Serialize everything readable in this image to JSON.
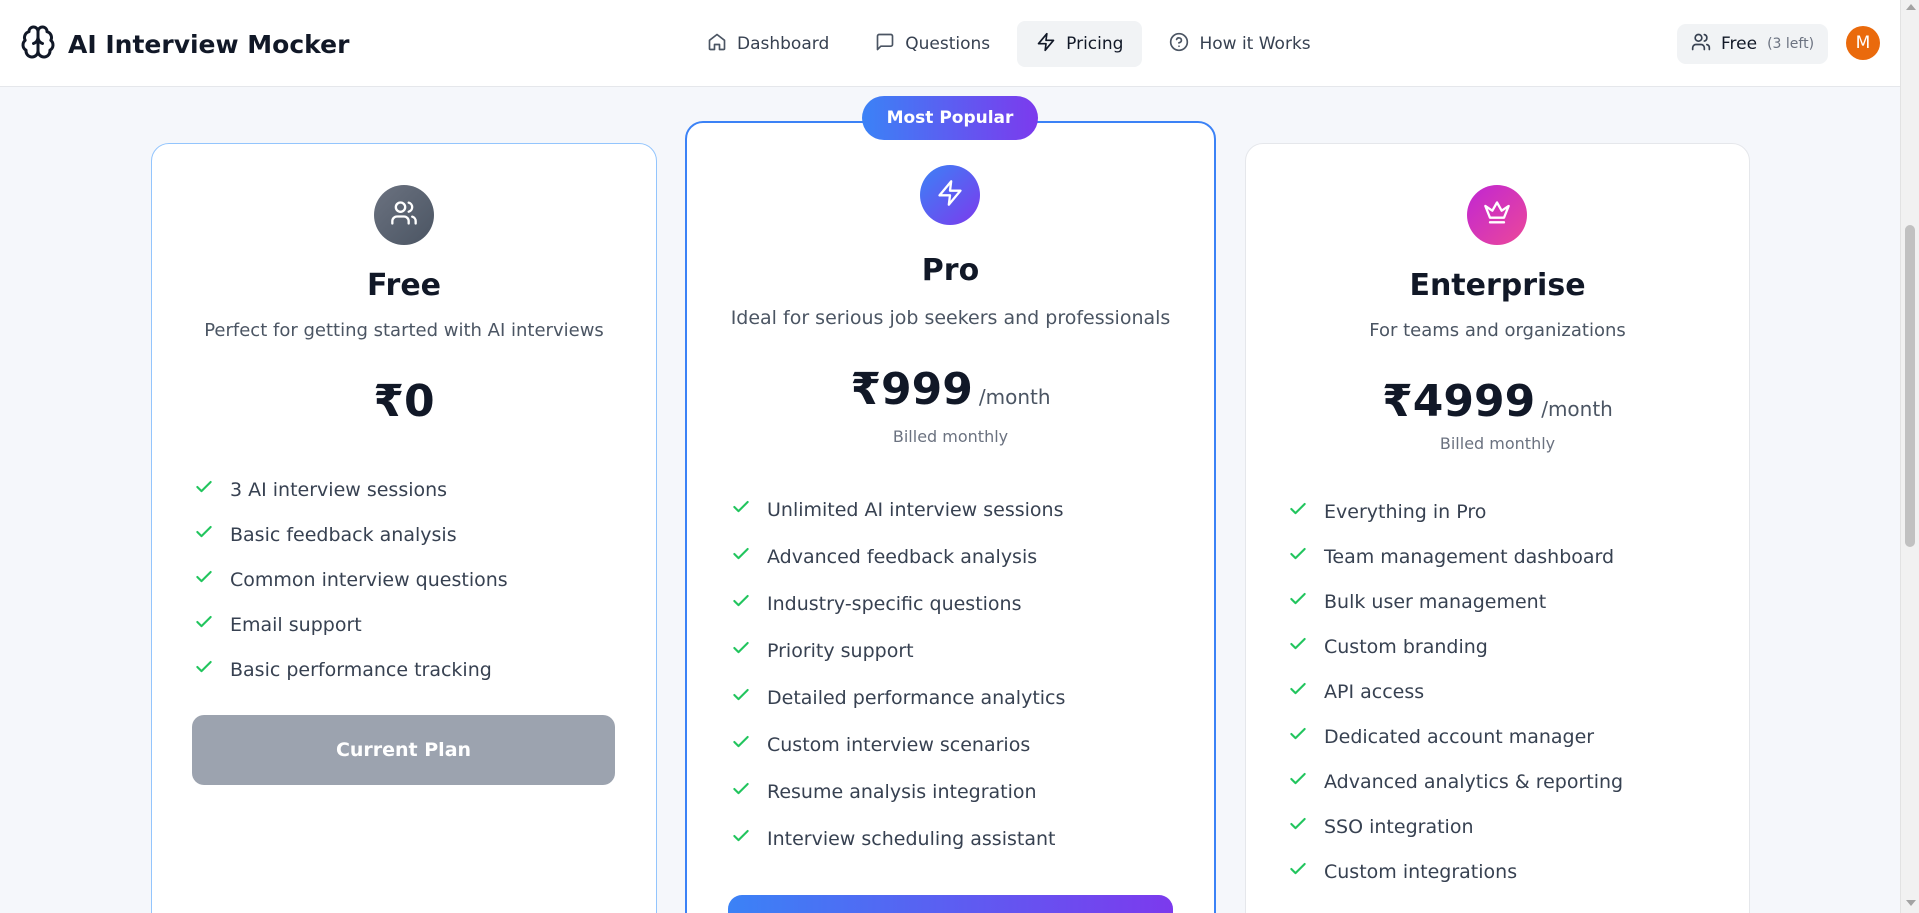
{
  "app": {
    "title": "AI Interview Mocker"
  },
  "nav": {
    "items": [
      {
        "label": "Dashboard",
        "icon": "home-icon"
      },
      {
        "label": "Questions",
        "icon": "message-square-icon"
      },
      {
        "label": "Pricing",
        "icon": "zap-icon",
        "active": true
      },
      {
        "label": "How it Works",
        "icon": "help-circle-icon"
      }
    ]
  },
  "user": {
    "plan_label": "Free",
    "sessions_left": "(3 left)",
    "avatar_initial": "M",
    "avatar_color": "#ea6a0c"
  },
  "colors": {
    "accent_blue": "#3b82f6",
    "accent_purple": "#7c3aed",
    "check_green": "#22c55e",
    "enterprise_pink": "#db2777"
  },
  "plans": {
    "free": {
      "name": "Free",
      "description": "Perfect for getting started with AI interviews",
      "price": "₹0",
      "features": [
        "3 AI interview sessions",
        "Basic feedback analysis",
        "Common interview questions",
        "Email support",
        "Basic performance tracking"
      ],
      "button_label": "Current Plan",
      "icon": "users-icon"
    },
    "pro": {
      "badge": "Most Popular",
      "name": "Pro",
      "description": "Ideal for serious job seekers and professionals",
      "price": "₹999",
      "period": "/month",
      "billing": "Billed monthly",
      "features": [
        "Unlimited AI interview sessions",
        "Advanced feedback analysis",
        "Industry-specific questions",
        "Priority support",
        "Detailed performance analytics",
        "Custom interview scenarios",
        "Resume analysis integration",
        "Interview scheduling assistant"
      ],
      "icon": "zap-icon"
    },
    "enterprise": {
      "name": "Enterprise",
      "description": "For teams and organizations",
      "price": "₹4999",
      "period": "/month",
      "billing": "Billed monthly",
      "features": [
        "Everything in Pro",
        "Team management dashboard",
        "Bulk user management",
        "Custom branding",
        "API access",
        "Dedicated account manager",
        "Advanced analytics & reporting",
        "SSO integration",
        "Custom integrations"
      ],
      "icon": "crown-icon"
    }
  }
}
